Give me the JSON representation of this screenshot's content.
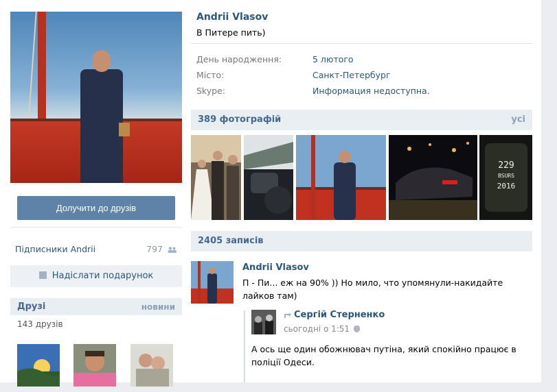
{
  "profile": {
    "name": "Andrii Vlasov",
    "status": "В Питере пить)",
    "info": [
      {
        "label": "День народження:",
        "value": "5 лютого"
      },
      {
        "label": "Місто:",
        "value": "Санкт-Петербург"
      },
      {
        "label": "Skype:",
        "value": "Информация недоступна."
      }
    ]
  },
  "actions": {
    "add_friend": "Долучити до друзів",
    "send_gift": "Надіслати подарунок"
  },
  "followers": {
    "label": "Підписники Andrii",
    "count": "797"
  },
  "friends": {
    "title": "Друзі",
    "link": "новини",
    "count_label": "143 друзів"
  },
  "photos": {
    "title": "389 фотографій",
    "link": "усі",
    "tile_texts": [
      "229",
      "BSURS",
      "2016"
    ]
  },
  "wall": {
    "title": "2405 записів",
    "post": {
      "author": "Andrii Vlasov",
      "text": "П - Пи... еж на 90% )) Но мило, что упомянули-накидайте лайков там)"
    },
    "repost": {
      "author": "Сергій Стерненко",
      "time": "сьогодні о 1:51",
      "text": "А ось ще один обожнювач путіна, який спокійно працює в поліції Одеси."
    }
  },
  "colors": {
    "link": "#2b587a",
    "button": "#5e82a8",
    "section_bg": "#e9eef3"
  }
}
